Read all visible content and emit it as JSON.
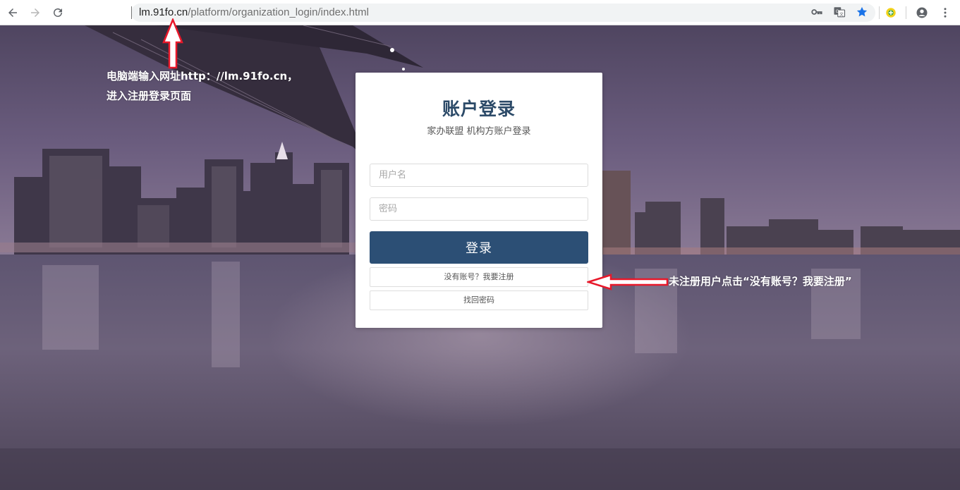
{
  "browser": {
    "url_host": "lm.91fo.cn",
    "url_path": "/platform/organization_login/index.html",
    "icons": [
      "back-arrow-icon",
      "forward-arrow-icon",
      "reload-icon",
      "key-icon",
      "translate-icon",
      "bookmark-star-icon",
      "extension-icon",
      "account-icon",
      "menu-dots-icon"
    ]
  },
  "login": {
    "title": "账户登录",
    "subtitle": "家办联盟 机构方账户登录",
    "username_placeholder": "用户名",
    "password_placeholder": "密码",
    "login_label": "登录",
    "register_label": "没有账号？我要注册",
    "forgot_label": "找回密码"
  },
  "annotations": {
    "url_line1": "电脑端输入网址http：//lm.91fo.cn，",
    "url_line2": "进入注册登录页面",
    "register_hint": "未注册用户点击“没有账号？我要注册”"
  },
  "colors": {
    "title": "#2c4a68",
    "login_button": "#2c4f75",
    "annotation_arrow": "#e8182a",
    "bookmark_star": "#1a73e8"
  }
}
